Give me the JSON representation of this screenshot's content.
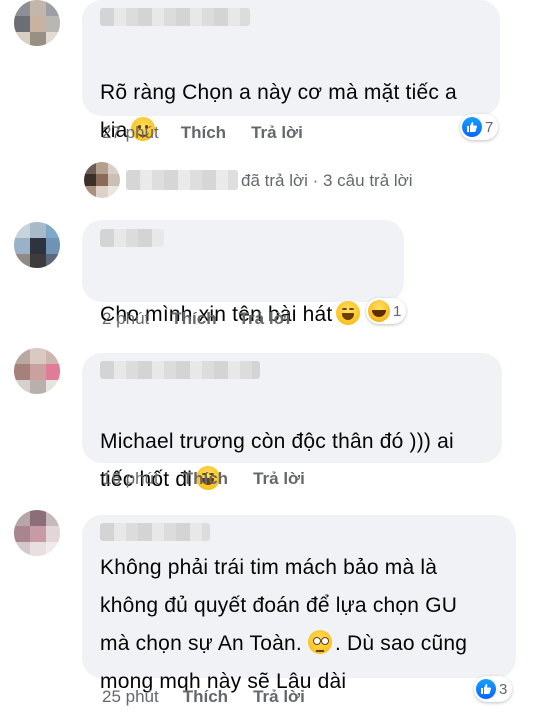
{
  "comments": [
    {
      "text": "Rõ ràng Chọn a này cơ mà mặt tiếc a\nkia",
      "time": "27 phút",
      "like_label": "Thích",
      "reply_label": "Trả lời",
      "reaction_count": "7",
      "reaction_icon": "like-icon",
      "emoji": "slightly-smiling-face"
    },
    {
      "text": "Cho mình xin tên bài hát",
      "time": "2 phút",
      "like_label": "Thích",
      "reply_label": "Trả lời",
      "reaction_count": "1",
      "reaction_icon": "haha-icon",
      "emoji": "tears-of-joy"
    },
    {
      "text": "Michael trương còn độc thân đó ))) ai\ntiếc hốt đi",
      "time": "16 phút",
      "like_label": "Thích",
      "reply_label": "Trả lời",
      "emoji": "tears-of-joy"
    },
    {
      "text_line1": "Không phải trái tim mách bảo mà là",
      "text_line2": "không đủ quyết đoán để lựa chọn GU",
      "text_line3a": "mà chọn sự An Toàn.",
      "text_line3b": ". Dù sao cũng",
      "text_line4": "mong mqh này sẽ Lâu dài",
      "time": "25 phút",
      "like_label": "Thích",
      "reply_label": "Trả lời",
      "reaction_count": "3",
      "reaction_icon": "like-icon",
      "emoji": "rolling-eyes"
    }
  ],
  "reply_thread": {
    "text": "đã trả lời · 3 câu trả lời"
  },
  "colors": {
    "bubble": "#f0f2f5",
    "meta": "#65676b",
    "like_blue": "#0866ff"
  }
}
